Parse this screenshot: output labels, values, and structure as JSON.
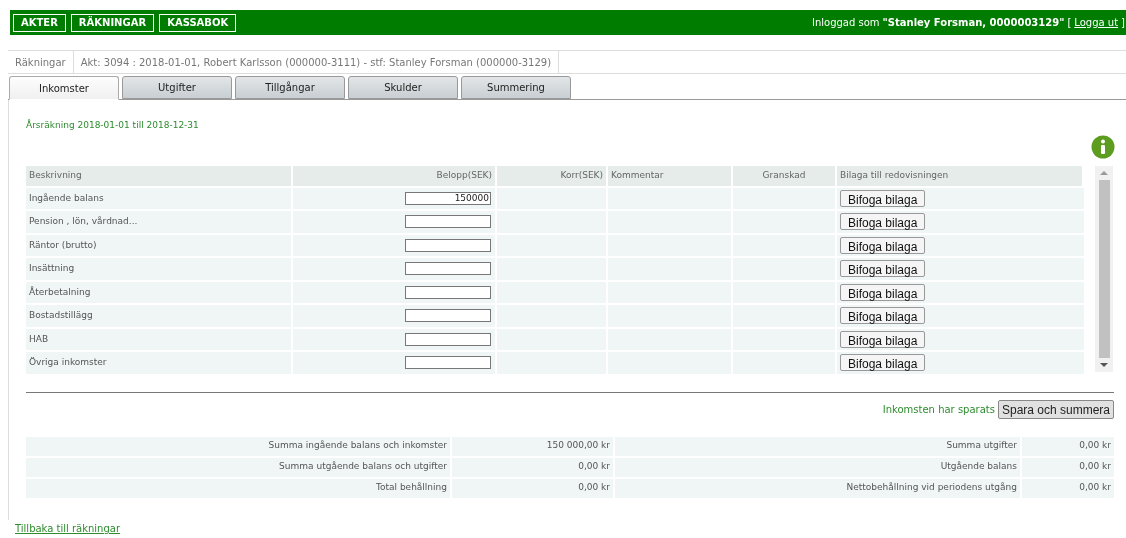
{
  "top_nav": {
    "buttons": [
      "AKTER",
      "RÄKNINGAR",
      "KASSABOK"
    ],
    "login_prefix": "Inloggad som",
    "login_user": "\"Stanley Forsman, 0000003129\"",
    "logout_open": "[",
    "logout_link": "Logga ut",
    "logout_close": "]"
  },
  "breadcrumb": [
    "Räkningar",
    "Akt: 3094 : 2018-01-01, Robert Karlsson (000000-3111) - stf: Stanley Forsman (000000-3129)"
  ],
  "tabs": [
    {
      "label": "Inkomster",
      "selected": true
    },
    {
      "label": "Utgifter",
      "selected": false
    },
    {
      "label": "Tillgångar",
      "selected": false
    },
    {
      "label": "Skulder",
      "selected": false
    },
    {
      "label": "Summering",
      "selected": false
    }
  ],
  "period": "Årsräkning 2018-01-01 till 2018-12-31",
  "table": {
    "columns": [
      "Beskrivning",
      "Belopp(SEK)",
      "Korr(SEK)",
      "Kommentar",
      "Granskad",
      "Bilaga till redovisningen"
    ],
    "rows": [
      {
        "description": "Ingående balans",
        "amount": "150000",
        "attach": "Bifoga bilaga"
      },
      {
        "description": "Pension , lön, vårdnad...",
        "attach": "Bifoga bilaga"
      },
      {
        "description": "Räntor (brutto)",
        "attach": "Bifoga bilaga"
      },
      {
        "description": "Insättning",
        "attach": "Bifoga bilaga"
      },
      {
        "description": "Återbetalning",
        "attach": "Bifoga bilaga"
      },
      {
        "description": "Bostadstillägg",
        "attach": "Bifoga bilaga"
      },
      {
        "description": "HAB",
        "attach": "Bifoga bilaga"
      },
      {
        "description": "Övriga inkomster",
        "attach": "Bifoga bilaga"
      }
    ]
  },
  "save": {
    "status": "Inkomsten har sparats",
    "button": "Spara och summera"
  },
  "summary": [
    {
      "label": "Summa ingående balans och inkomster",
      "value": "150 000,00 kr",
      "label2": "Summa utgifter",
      "value2": "0,00 kr"
    },
    {
      "label": "Summa utgående balans och utgifter",
      "value": "0,00 kr",
      "label2": "Utgående balans",
      "value2": "0,00 kr"
    },
    {
      "label": "Total behållning",
      "value": "0,00 kr",
      "label2": "Nettobehållning vid periodens utgång",
      "value2": "0,00 kr"
    }
  ],
  "back_link": "Tillbaka till räkningar"
}
